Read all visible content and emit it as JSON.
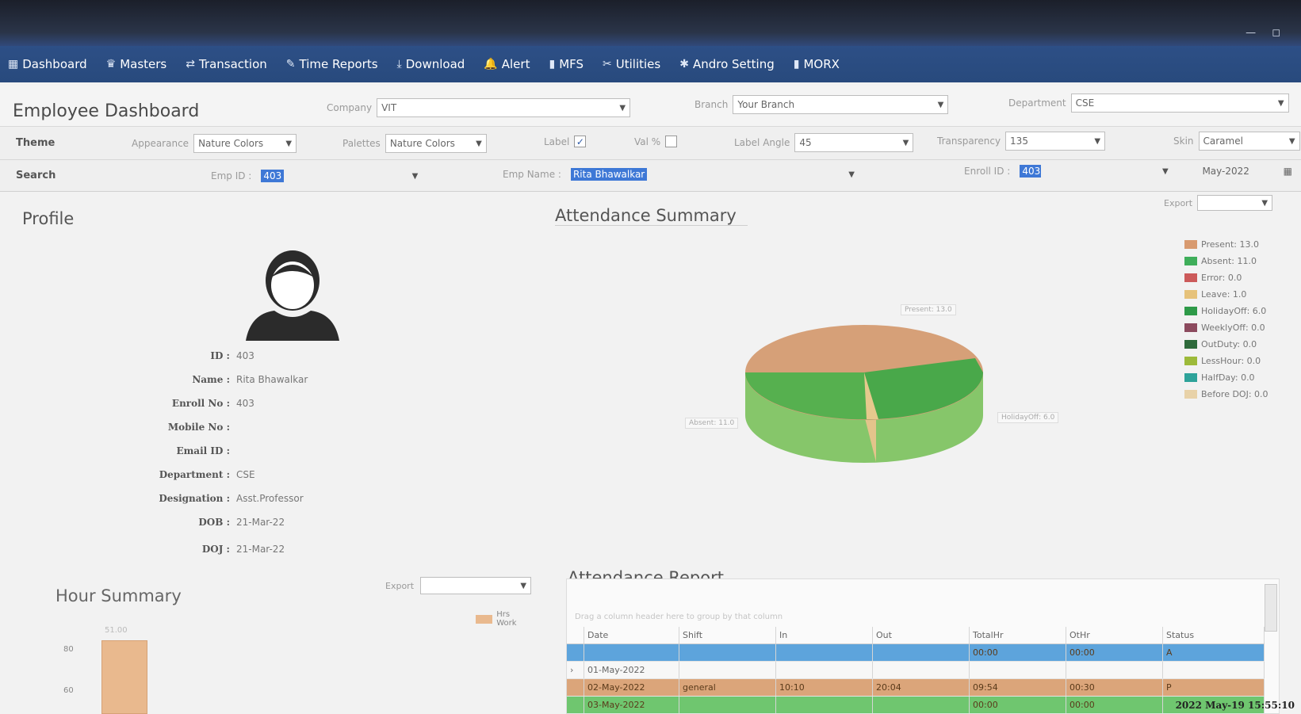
{
  "menu": [
    {
      "icon": "dashboard-icon",
      "glyph": "▦",
      "label": "Dashboard"
    },
    {
      "icon": "masters-icon",
      "glyph": "♛",
      "label": "Masters"
    },
    {
      "icon": "transaction-icon",
      "glyph": "⇄",
      "label": "Transaction"
    },
    {
      "icon": "time-reports-icon",
      "glyph": "✎",
      "label": "Time Reports"
    },
    {
      "icon": "download-icon",
      "glyph": "⤓",
      "label": "Download"
    },
    {
      "icon": "alert-icon",
      "glyph": "🔔",
      "label": "Alert"
    },
    {
      "icon": "mfs-icon",
      "glyph": "▮",
      "label": "MFS"
    },
    {
      "icon": "utilities-icon",
      "glyph": "✂",
      "label": "Utilities"
    },
    {
      "icon": "andro-setting-icon",
      "glyph": "✱",
      "label": "Andro Setting"
    },
    {
      "icon": "morx-icon",
      "glyph": "▮",
      "label": "MORX"
    }
  ],
  "header": {
    "title": "Employee Dashboard",
    "company_label": "Company",
    "company_value": "VIT",
    "branch_label": "Branch",
    "branch_value": "Your Branch",
    "department_label": "Department",
    "department_value": "CSE"
  },
  "theme": {
    "row_label": "Theme",
    "appearance_label": "Appearance",
    "appearance_value": "Nature Colors",
    "palettes_label": "Palettes",
    "palettes_value": "Nature Colors",
    "label_label": "Label",
    "label_checked": "✓",
    "val_label": "Val %",
    "label_angle_label": "Label Angle",
    "label_angle_value": "45",
    "transparency_label": "Transparency",
    "transparency_value": "135",
    "skin_label": "Skin",
    "skin_value": "Caramel"
  },
  "search": {
    "row_label": "Search",
    "emp_id_label": "Emp ID :",
    "emp_id_value": "403",
    "emp_name_label": "Emp Name :",
    "emp_name_value": "Rita Bhawalkar",
    "enroll_label": "Enroll ID :",
    "enroll_value": "403",
    "month_value": "May-2022"
  },
  "profile": {
    "title": "Profile",
    "fields": [
      {
        "key": "ID :",
        "value": "403"
      },
      {
        "key": "Name :",
        "value": "Rita Bhawalkar"
      },
      {
        "key": "Enroll No :",
        "value": "403"
      },
      {
        "key": "Mobile No :",
        "value": ""
      },
      {
        "key": "Email ID :",
        "value": ""
      },
      {
        "key": "Department :",
        "value": "CSE"
      },
      {
        "key": "Designation :",
        "value": "Asst.Professor"
      },
      {
        "key": "DOB :",
        "value": "21-Mar-22"
      },
      {
        "key": "DOJ :",
        "value": "21-Mar-22"
      }
    ]
  },
  "attendance_summary": {
    "title": "Attendance Summary",
    "export_label": "Export",
    "pie_labels": {
      "present": "Present: 13.0",
      "absent": "Absent: 11.0",
      "holiday": "HolidayOff: 6.0"
    },
    "legend": [
      {
        "label": "Present: 13.0",
        "color": "#d89a6f"
      },
      {
        "label": "Absent: 11.0",
        "color": "#3fae5a"
      },
      {
        "label": "Error: 0.0",
        "color": "#cc5a5a"
      },
      {
        "label": "Leave: 1.0",
        "color": "#e6c27a"
      },
      {
        "label": "HolidayOff: 6.0",
        "color": "#2e9a48"
      },
      {
        "label": "WeeklyOff: 0.0",
        "color": "#8c4a5e"
      },
      {
        "label": "OutDuty: 0.0",
        "color": "#2f6b3c"
      },
      {
        "label": "LessHour: 0.0",
        "color": "#9dba3a"
      },
      {
        "label": "HalfDay: 0.0",
        "color": "#2ea39a"
      },
      {
        "label": "Before DOJ: 0.0",
        "color": "#e8d2a8"
      }
    ]
  },
  "hour_summary": {
    "title": "Hour Summary",
    "export_label": "Export",
    "legend_label": "Hrs Work",
    "bar_label": "51.00",
    "y_ticks": [
      "80",
      "60"
    ]
  },
  "attendance_report": {
    "title": "Attendance Report",
    "group_hint": "Drag a column header here to group by that column",
    "columns": [
      "",
      "Date",
      "Shift",
      "In",
      "Out",
      "TotalHr",
      "OtHr",
      "Status"
    ],
    "rows": [
      {
        "cells": [
          "",
          "",
          "",
          "",
          "",
          "00:00",
          "00:00",
          "A"
        ],
        "bg": "#5da4dc"
      },
      {
        "cells": [
          "›",
          "01-May-2022",
          "",
          "",
          "",
          "",
          "",
          ""
        ],
        "bg": "#f7f7f7"
      },
      {
        "cells": [
          "",
          "02-May-2022",
          "general",
          "10:10",
          "20:04",
          "09:54",
          "00:30",
          "P"
        ],
        "bg": "#dba57a"
      },
      {
        "cells": [
          "",
          "03-May-2022",
          "",
          "",
          "",
          "00:00",
          "00:00",
          ""
        ],
        "bg": "#6fc66f"
      }
    ]
  },
  "photo_timestamp": "2022 May-19 15:55:10"
}
